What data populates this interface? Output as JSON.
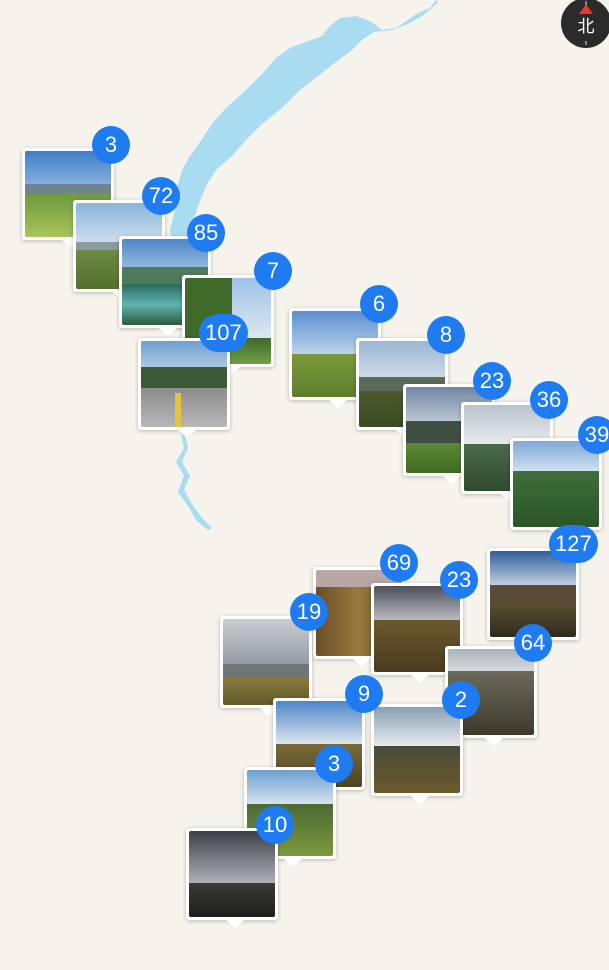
{
  "compass": {
    "label": "北"
  },
  "colors": {
    "badge": "#1e7bf1",
    "water": "#a9dcf0",
    "ground": "#f6f3ec"
  },
  "clusters": [
    {
      "count": "3"
    },
    {
      "count": "72"
    },
    {
      "count": "85"
    },
    {
      "count": "7"
    },
    {
      "count": "107"
    },
    {
      "count": "6"
    },
    {
      "count": "8"
    },
    {
      "count": "23"
    },
    {
      "count": "36"
    },
    {
      "count": "39"
    },
    {
      "count": "127"
    },
    {
      "count": "69"
    },
    {
      "count": "23"
    },
    {
      "count": "19"
    },
    {
      "count": "64"
    },
    {
      "count": "9"
    },
    {
      "count": "2"
    },
    {
      "count": "3"
    },
    {
      "count": "10"
    }
  ]
}
